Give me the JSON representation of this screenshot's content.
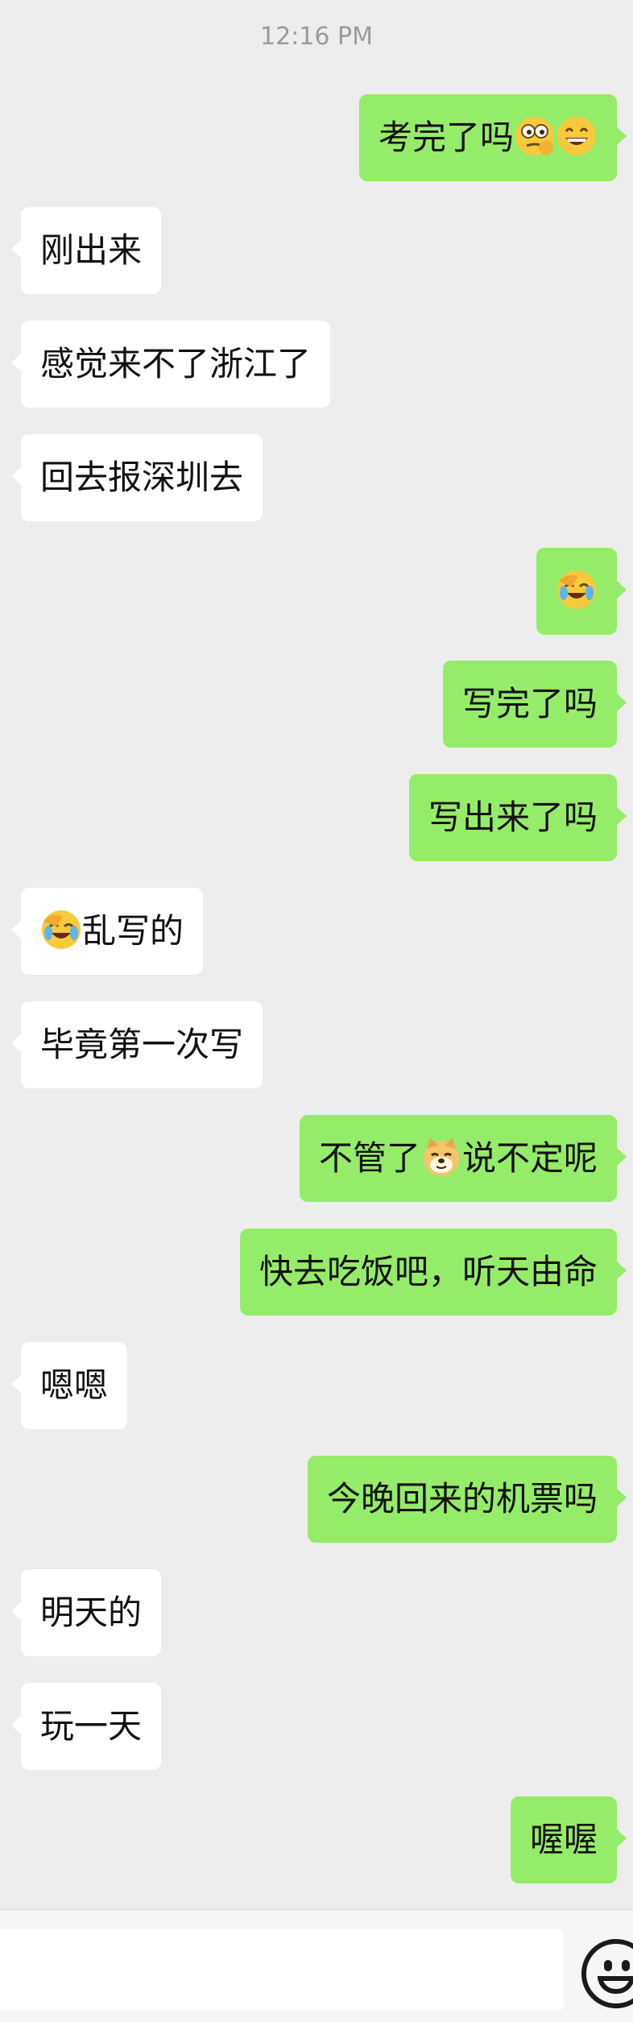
{
  "timestamp": "12:16 PM",
  "messages": [
    {
      "side": "right",
      "text": "考完了吗",
      "emojis_after": [
        "thinking-face-icon",
        "grinning-face-icon"
      ]
    },
    {
      "side": "left",
      "text": "刚出来"
    },
    {
      "side": "left",
      "text": "感觉来不了浙江了"
    },
    {
      "side": "left",
      "text": "回去报深圳去"
    },
    {
      "side": "right",
      "text": "",
      "emojis_after": [
        "facepalm-laughing-icon"
      ]
    },
    {
      "side": "right",
      "text": "写完了吗"
    },
    {
      "side": "right",
      "text": "写出来了吗"
    },
    {
      "side": "left",
      "text": "乱写的",
      "emojis_before": [
        "facepalm-laughing-icon"
      ]
    },
    {
      "side": "left",
      "text": "毕竟第一次写"
    },
    {
      "side": "right",
      "text_before": "不管了",
      "text": "说不定呢",
      "emoji_middle": "doge-icon"
    },
    {
      "side": "right",
      "text": "快去吃饭吧，听天由命"
    },
    {
      "side": "left",
      "text": "嗯嗯"
    },
    {
      "side": "right",
      "text": "今晚回来的机票吗"
    },
    {
      "side": "left",
      "text": "明天的"
    },
    {
      "side": "left",
      "text": "玩一天"
    },
    {
      "side": "right",
      "text": "喔喔"
    }
  ],
  "input_bar": {
    "placeholder": "",
    "emoji_button_icon": "smiley-face-icon"
  },
  "colors": {
    "background": "#ededed",
    "outgoing_bubble": "#95ec69",
    "incoming_bubble": "#ffffff",
    "timestamp_text": "#9b9b9b"
  }
}
